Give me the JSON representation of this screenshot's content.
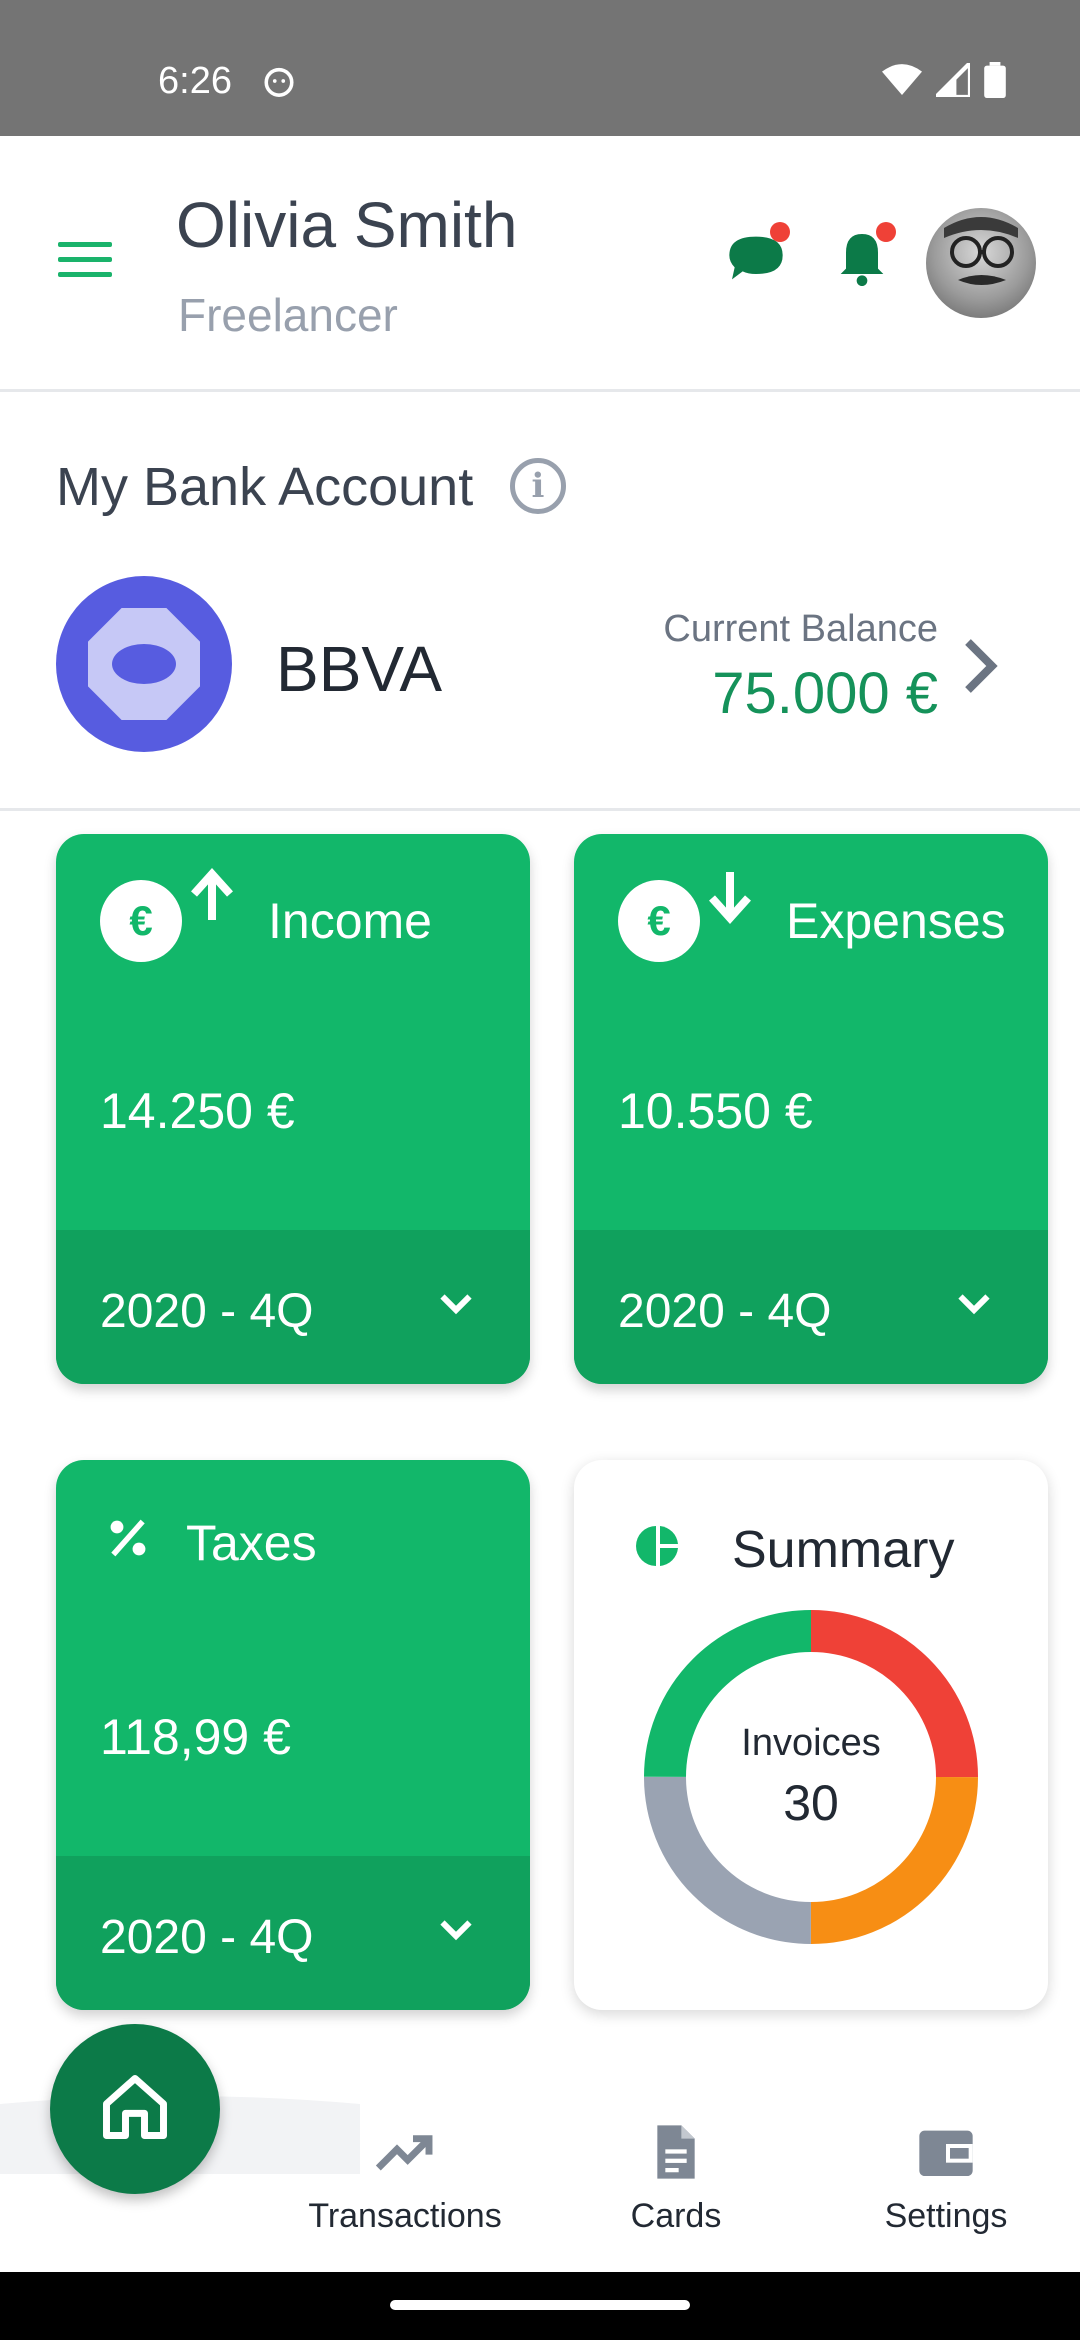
{
  "status_bar": {
    "time": "6:26"
  },
  "header": {
    "name": "Olivia Smith",
    "role": "Freelancer"
  },
  "bank_account": {
    "title": "My Bank Account",
    "bank_name": "BBVA",
    "balance_label": "Current Balance",
    "balance_value": "75.000 €"
  },
  "cards": {
    "income": {
      "title": "Income",
      "amount": "14.250 €",
      "period": "2020 - 4Q",
      "icon": "euro-up-icon"
    },
    "expenses": {
      "title": "Expenses",
      "amount": "10.550 €",
      "period": "2020 - 4Q",
      "icon": "euro-down-icon"
    },
    "taxes": {
      "title": "Taxes",
      "amount": "118,99 €",
      "period": "2020 - 4Q",
      "icon": "percent-icon"
    },
    "summary": {
      "title": "Summary",
      "label": "Invoices",
      "value": "30"
    }
  },
  "colors": {
    "accent": "#12b76a",
    "accent_dark": "#10a15d",
    "fab": "#0c7a48",
    "notification_dot": "#ef4137",
    "donut": [
      "#ef4137",
      "#f78e14",
      "#9aa3b2",
      "#12b76a"
    ]
  },
  "bottom_nav": {
    "items": [
      {
        "label": "Transactions",
        "icon": "trending-up-icon"
      },
      {
        "label": "Cards",
        "icon": "document-icon"
      },
      {
        "label": "Settings",
        "icon": "wallet-icon"
      }
    ],
    "home_icon": "home-icon"
  }
}
